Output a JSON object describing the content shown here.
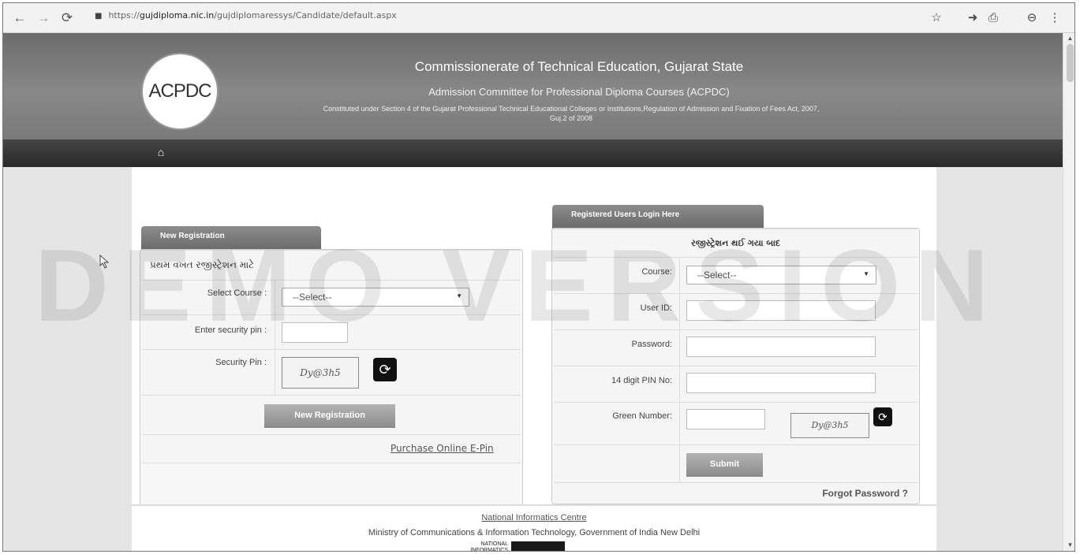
{
  "browser": {
    "url_prefix": "https://",
    "url_domain": "gujdiploma.nic.in",
    "url_path": "/gujdiplomaressys/Candidate/default.aspx"
  },
  "header": {
    "logo_text": "ACPDC",
    "title": "Commissionerate of Technical Education, Gujarat State",
    "subtitle": "Admission Committee for Professional Diploma Courses (ACPDC)",
    "constitution_line1": "Constituted under Section 4 of the Gujarat Professional Technical Educational Colleges or Institutions,Regulation of Admission and Fixation of Fees Act, 2007,",
    "constitution_line2": "Guj.2 of 2008"
  },
  "watermark": "DEMO VERSION",
  "new_registration": {
    "tab": "New Registration",
    "heading": "પ્રથમ વખત રજીસ્ટ્રેશન માટે",
    "select_course_label": "Select Course :",
    "select_course_value": "--Select--",
    "security_pin_label": "Enter security pin :",
    "security_pin_value": "",
    "captcha_label": "Security Pin :",
    "captcha_text": "Dy@3h5",
    "button": "New Registration",
    "purchase_link": "Purchase Online E-Pin"
  },
  "login": {
    "tab": "Registered Users Login Here",
    "heading": "રજીસ્ટ્રેશન થઈ ગયા બાદ",
    "course_label": "Course:",
    "course_value": "--Select--",
    "userid_label": "User ID:",
    "userid_value": "",
    "password_label": "Password:",
    "password_value": "",
    "pin_label": "14 digit PIN No:",
    "pin_value": "",
    "green_label": "Green Number:",
    "green_value": "",
    "captcha_text": "Dy@3h5",
    "submit": "Submit",
    "forgot": "Forgot Password ?"
  },
  "footer": {
    "nic": "National Informatics Centre",
    "ministry": "Ministry of Communications & Information Technology, Government of India New Delhi",
    "nic_logo_small": "NATIONAL INFORMATICS"
  }
}
